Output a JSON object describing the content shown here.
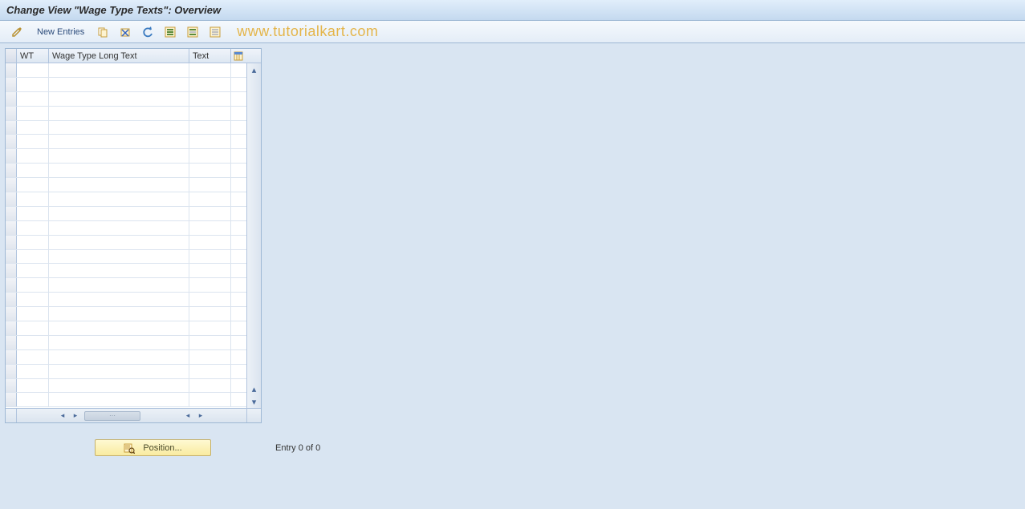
{
  "title": "Change View \"Wage Type Texts\": Overview",
  "toolbar": {
    "new_entries": "New Entries"
  },
  "watermark": "www.tutorialkart.com",
  "table": {
    "columns": {
      "wt": "WT",
      "long": "Wage Type Long Text",
      "text": "Text"
    },
    "row_count": 24
  },
  "footer": {
    "position_label": "Position...",
    "entry_text": "Entry 0 of 0"
  }
}
